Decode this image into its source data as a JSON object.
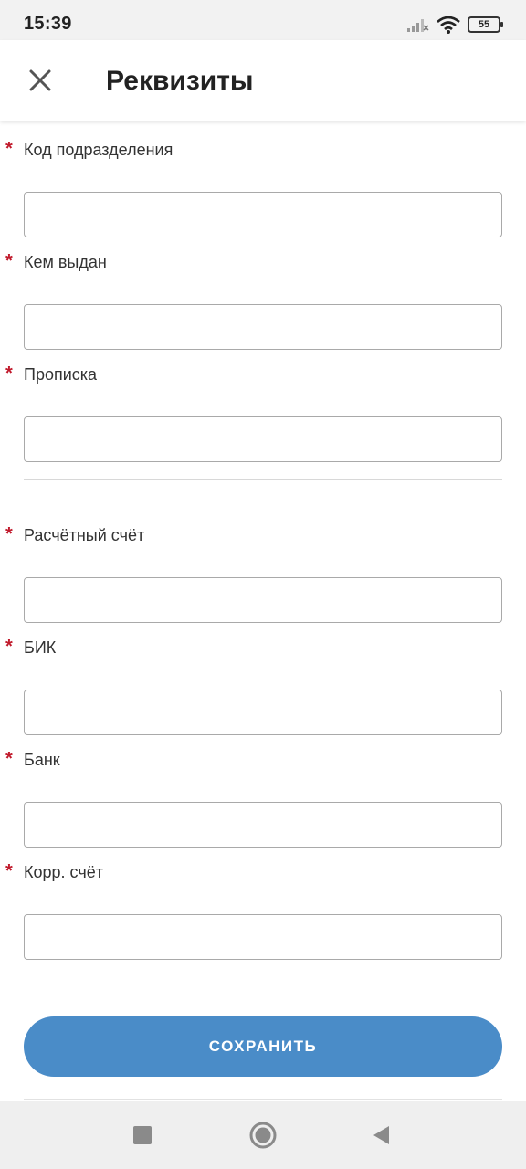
{
  "status_bar": {
    "time": "15:39",
    "battery_level": "55",
    "icons": [
      "signal-icon",
      "wifi-icon",
      "battery-icon"
    ]
  },
  "app_bar": {
    "close_icon": "close-icon",
    "title": "Реквизиты"
  },
  "form": {
    "required_mark": "*",
    "fields": [
      {
        "label": "Код подразделения",
        "value": ""
      },
      {
        "label": "Кем выдан",
        "value": ""
      },
      {
        "label": "Прописка",
        "value": ""
      },
      {
        "label": "Расчётный счёт",
        "value": ""
      },
      {
        "label": "БИК",
        "value": ""
      },
      {
        "label": "Банк",
        "value": ""
      },
      {
        "label": "Корр. счёт",
        "value": ""
      }
    ]
  },
  "actions": {
    "save_label": "СОХРАНИТЬ"
  },
  "nav_bar": {
    "icons": [
      "recents-square-icon",
      "home-circle-icon",
      "back-triangle-icon"
    ]
  },
  "colors": {
    "accent": "#4a8cc8",
    "required": "#c0192b"
  }
}
